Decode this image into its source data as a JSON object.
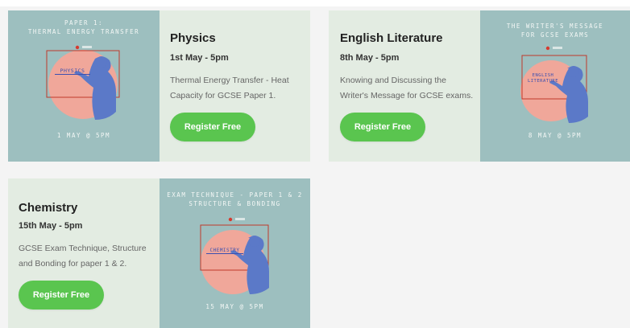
{
  "cards": [
    {
      "title": "Physics",
      "date": "1st May - 5pm",
      "description": "Thermal Energy Transfer - Heat Capacity for GCSE Paper 1.",
      "button": "Register Free",
      "poster": {
        "header": "PAPER 1:\nTHERMAL ENERGY TRANSFER",
        "board_label": "PHYSICS",
        "footer": "1 MAY @ 5PM"
      }
    },
    {
      "title": "English Literature",
      "date": "8th May - 5pm",
      "description": "Knowing and Discussing the Writer's Message for GCSE exams.",
      "button": "Register Free",
      "poster": {
        "header": "THE WRITER'S MESSAGE\nFOR GCSE EXAMS",
        "board_label": "ENGLISH\nLITERATURE",
        "footer": "8 MAY @ 5PM"
      }
    },
    {
      "title": "Chemistry",
      "date": "15th May - 5pm",
      "description": "GCSE Exam Technique, Structure and Bonding for paper 1 & 2.",
      "button": "Register Free",
      "poster": {
        "header": "EXAM TECHNIQUE - PAPER 1 & 2\nSTRUCTURE & BONDING",
        "board_label": "CHEMISTRY",
        "footer": "15 MAY @ 5PM"
      }
    }
  ],
  "colors": {
    "card_bg": "#e3ece2",
    "poster_bg": "#9dbfbf",
    "button": "#5ac54f",
    "circle": "#f0a79a",
    "figure": "#5b79c8",
    "frame": "#c0392b"
  },
  "icons": [
    "teacher-illustration",
    "whiteboard-frame",
    "live-dot-icon"
  ]
}
